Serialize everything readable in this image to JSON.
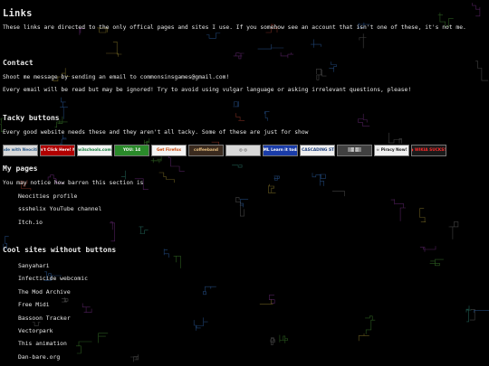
{
  "page": {
    "title": "Links",
    "intro": "These links are directed to the only offical pages and sites I use. If you somehow see an account that isn't one of these, it's not me."
  },
  "contact": {
    "heading": "Contact",
    "line1": "Shoot me message by sending an email to commonsinsgames@gmail.com!",
    "line2": "Every email will be read but may be ignored! Try to avoid using vulgar language or asking irrelevant questions, please!"
  },
  "tacky": {
    "heading": "Tacky buttons",
    "text": "Every good website needs these and they aren't all tacky. Some of these are just for show",
    "buttons": [
      {
        "name": "made-with-neocities-button",
        "label": "Made with Neocities",
        "bg": "#d9d9d9",
        "fg": "#2a5a8a"
      },
      {
        "name": "dont-click-here-button",
        "label": "Don't Click Here! NO!",
        "bg": "#b00000",
        "fg": "#ffffff"
      },
      {
        "name": "w3schools-button",
        "label": "w3schools.com",
        "bg": "#f2f2f2",
        "fg": "#0a7a36"
      },
      {
        "name": "you-14-button",
        "label": "YOU: 14",
        "bg": "#2a8a2a",
        "fg": "#ffffff"
      },
      {
        "name": "get-firefox-button",
        "label": "Get Firefox",
        "bg": "#f4f4f4",
        "fg": "#c84000"
      },
      {
        "name": "coffeeband-button",
        "label": "coffeeband",
        "bg": "#3a2a1e",
        "fg": "#e8c080"
      },
      {
        "name": "eye-button",
        "label": "◎ ◎",
        "bg": "#d8d8d8",
        "fg": "#222222"
      },
      {
        "name": "html-learn-it-button",
        "label": "HTML Learn it today!",
        "bg": "#1a3ca8",
        "fg": "#ffffff"
      },
      {
        "name": "made-with-css-button",
        "label": "MADE WITH CASCADING STYLE SHEETS",
        "bg": "#f0f0f0",
        "fg": "#1a3c7a"
      },
      {
        "name": "pixel-art-button",
        "label": "▒▓ ▓▒",
        "bg": "#404040",
        "fg": "#d0d0d0"
      },
      {
        "name": "piracy-button",
        "label": "☠ Piracy Now!",
        "bg": "#f0f0f0",
        "fg": "#1a1a1a"
      },
      {
        "name": "wikia-sucks-button",
        "label": "● WIKIA SUCKS!!",
        "bg": "#1a1a1a",
        "fg": "#ff2a2a"
      }
    ]
  },
  "mypages": {
    "heading": "My pages",
    "text": "You may notice how barren this section is",
    "items": [
      "Neocities profile",
      "ssshelix YouTube channel",
      "Itch.io"
    ]
  },
  "cool": {
    "heading": "Cool sites without buttons",
    "items": [
      "Sanyahari",
      "Infecticide webcomic",
      "The Mod Archive",
      "Free Midi",
      "Bassoon Tracker",
      "Vectorpark",
      "This animation",
      "Dan-bare.org"
    ]
  }
}
